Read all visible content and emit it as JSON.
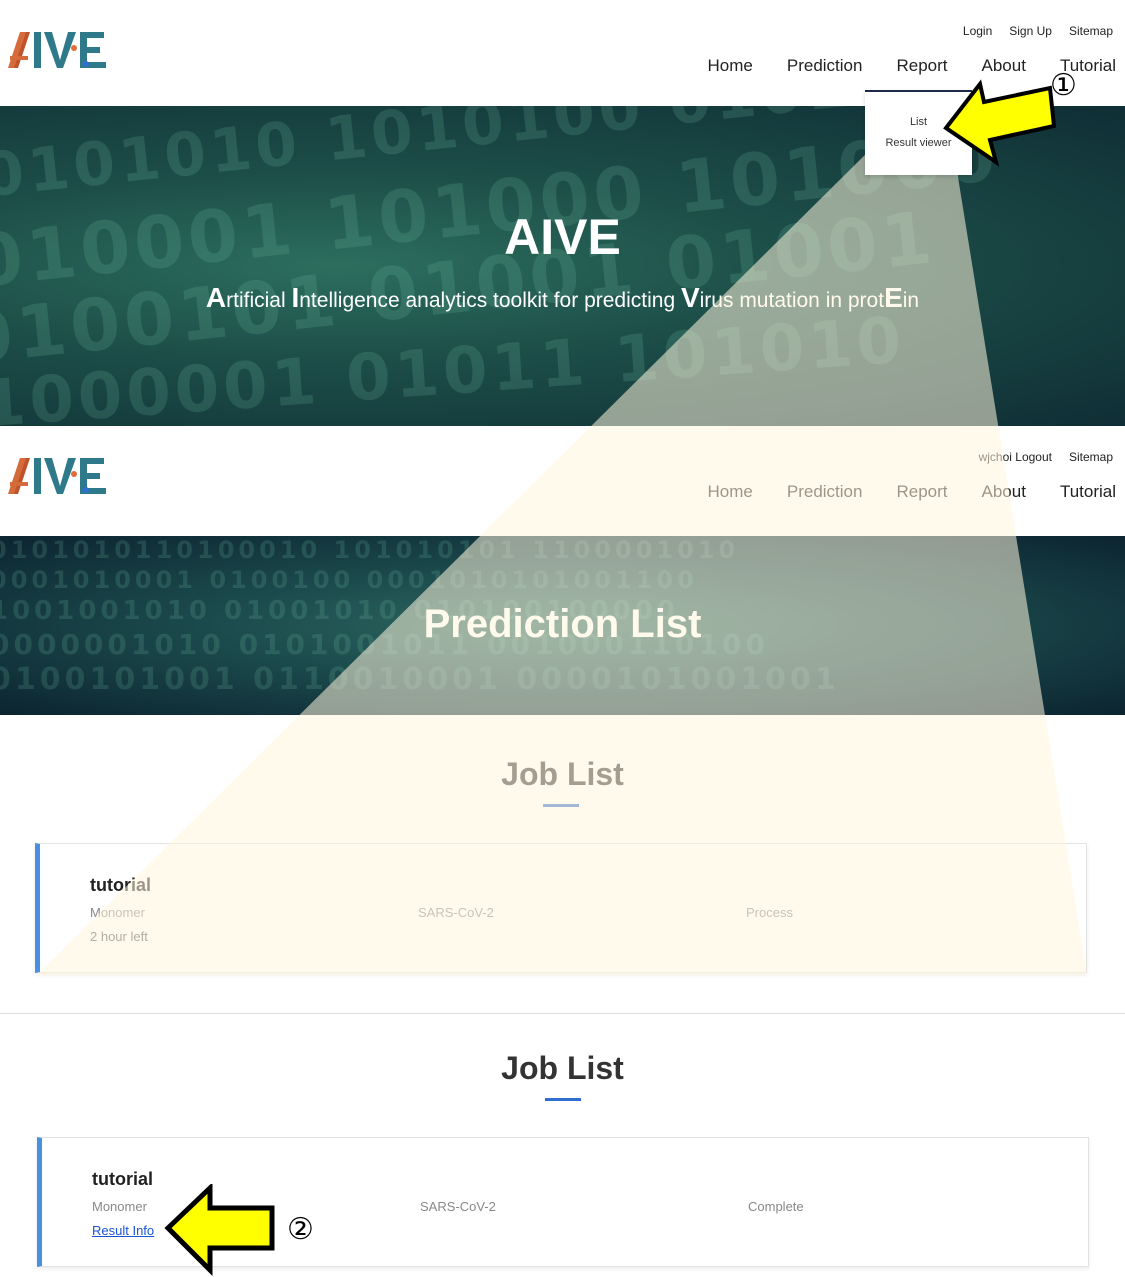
{
  "top": {
    "toplinks": [
      "Login",
      "Sign Up",
      "Sitemap"
    ],
    "nav": [
      "Home",
      "Prediction",
      "Report",
      "About",
      "Tutorial"
    ],
    "dropdown": [
      "List",
      "Result viewer"
    ],
    "hero_title": "AIVE",
    "hero_subtitle": {
      "A": "A",
      "p1": "rtificial ",
      "I": "I",
      "p2": "ntelligence analytics toolkit for predicting ",
      "V": "V",
      "p3": "irus mutation in prot",
      "E": "E",
      "p4": "in"
    }
  },
  "second": {
    "user": "wjchoi",
    "toplinks": [
      "Logout",
      "Sitemap"
    ],
    "nav": [
      "Home",
      "Prediction",
      "Report",
      "About",
      "Tutorial"
    ],
    "hero_title": "Prediction List"
  },
  "joblist1": {
    "title": "Job List",
    "card": {
      "name": "tutorial",
      "type": "Monomer",
      "virus": "SARS-CoV-2",
      "status": "Process",
      "time": "2 hour left"
    }
  },
  "joblist2": {
    "title": "Job List",
    "card": {
      "name": "tutorial",
      "type": "Monomer",
      "virus": "SARS-CoV-2",
      "status": "Complete",
      "link": "Result Info"
    }
  },
  "annotations": {
    "step1": "①",
    "step2": "②"
  },
  "colors": {
    "accent": "#2f6fd1",
    "card_border": "#4a8fe0",
    "highlight_arrow": "#ffff00",
    "cone": "#fff5dc"
  }
}
